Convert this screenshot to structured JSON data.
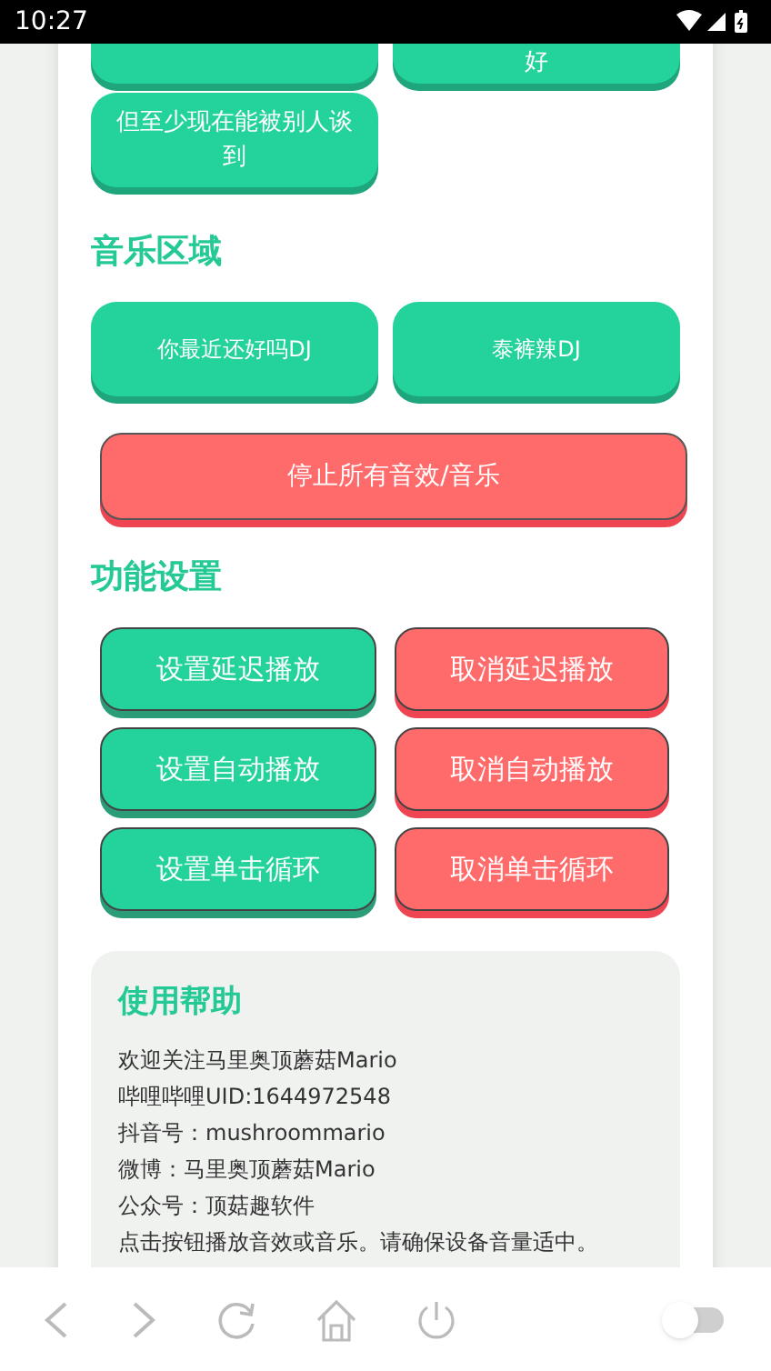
{
  "status_bar": {
    "time": "10:27"
  },
  "sound_buttons": [
    {
      "kind": "hidden"
    },
    {
      "kind": "label",
      "label": "好"
    },
    {
      "kind": "label",
      "label": "但至少现在能被别人谈到"
    }
  ],
  "music_section": {
    "title": "音乐区域",
    "buttons": [
      {
        "label": "你最近还好吗DJ"
      },
      {
        "label": "泰裤辣DJ"
      }
    ]
  },
  "stop_button": {
    "label": "停止所有音效/音乐"
  },
  "settings_section": {
    "title": "功能设置",
    "buttons": [
      {
        "label": "设置延迟播放",
        "kind": "set"
      },
      {
        "label": "取消延迟播放",
        "kind": "cancel"
      },
      {
        "label": "设置自动播放",
        "kind": "set"
      },
      {
        "label": "取消自动播放",
        "kind": "cancel"
      },
      {
        "label": "设置单击循环",
        "kind": "set"
      },
      {
        "label": "取消单击循环",
        "kind": "cancel"
      }
    ]
  },
  "help": {
    "title": "使用帮助",
    "lines": [
      "欢迎关注马里奥顶蘑菇Mario",
      "哔哩哔哩UID:1644972548",
      "抖音号：mushroommario",
      "微博：马里奥顶蘑菇Mario",
      "公众号：顶菇趣软件",
      "点击按钮播放音效或音乐。请确保设备音量适中。"
    ]
  },
  "bottom_bar": {
    "toggle": {
      "on": false
    }
  }
}
